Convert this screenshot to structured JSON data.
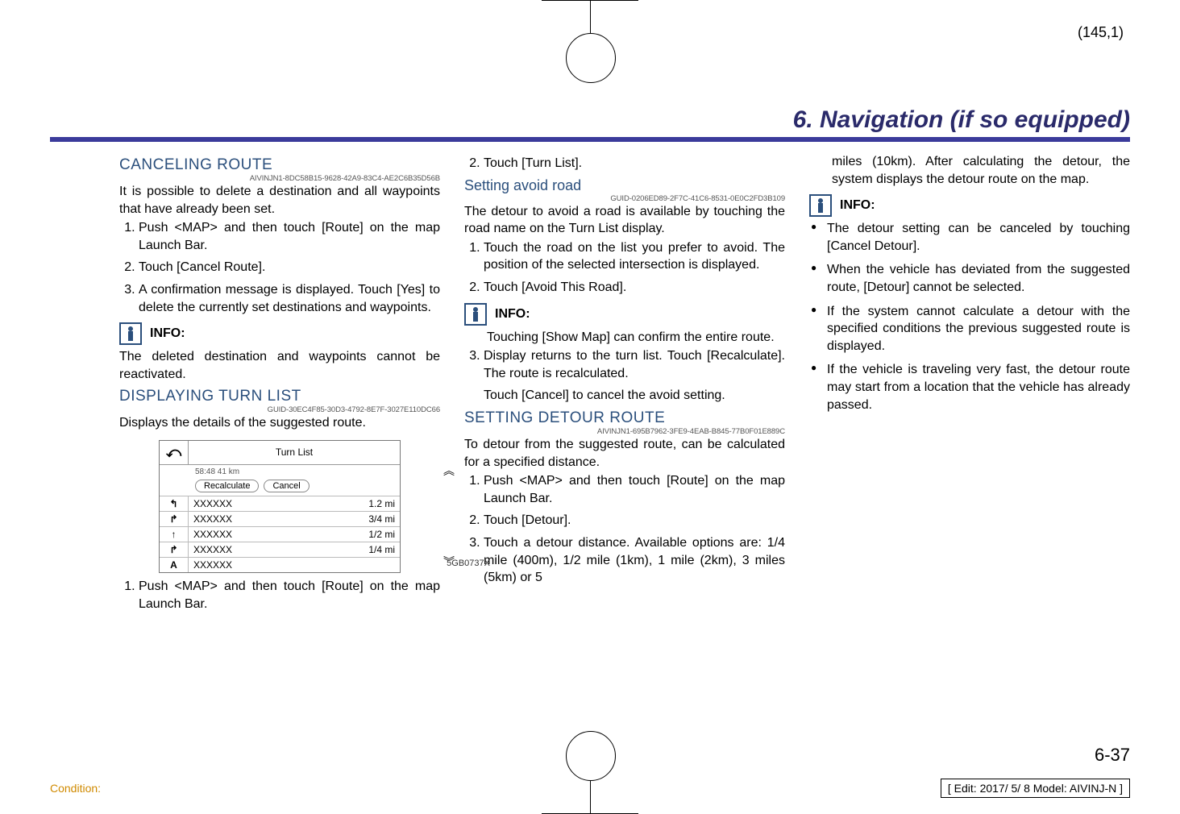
{
  "page_coord": "(145,1)",
  "section_title": "6. Navigation (if so equipped)",
  "col1": {
    "h_cancel": "CANCELING ROUTE",
    "guid_cancel": "AIVINJN1-8DC58B15-9628-42A9-83C4-AE2C6B35D56B",
    "p_cancel": "It is possible to delete a destination and all waypoints that have already been set.",
    "cancel_steps": [
      "Push <MAP> and then touch [Route] on the map Launch Bar.",
      "Touch [Cancel Route].",
      "A confirmation message is displayed. Touch [Yes] to delete the currently set destinations and waypoints."
    ],
    "info_label": "INFO:",
    "info_text": "The deleted destination and waypoints cannot be reactivated.",
    "h_turn": "DISPLAYING TURN LIST",
    "guid_turn": "GUID-30EC4F85-30D3-4792-8E7F-3027E110DC66",
    "p_turn": "Displays the details of the suggested route.",
    "turnlist": {
      "title": "Turn List",
      "meta": "58:48    41 km",
      "btn_recalc": "Recalculate",
      "btn_cancel": "Cancel",
      "rows": [
        {
          "dir": "↰",
          "name": "XXXXXX",
          "dist": "1.2 mi"
        },
        {
          "dir": "↱",
          "name": "XXXXXX",
          "dist": "3/4 mi"
        },
        {
          "dir": "↑",
          "name": "XXXXXX",
          "dist": "1/2 mi"
        },
        {
          "dir": "↱",
          "name": "XXXXXX",
          "dist": "1/4 mi"
        },
        {
          "dir": "A",
          "name": "XXXXXX",
          "dist": ""
        }
      ],
      "figref": "5GB0737X"
    },
    "turn_steps_first": "Push <MAP> and then touch [Route] on the map Launch Bar."
  },
  "col2": {
    "turn_step2": "Touch [Turn List].",
    "h_avoid": "Setting avoid road",
    "guid_avoid": "GUID-0206ED89-2F7C-41C6-8531-0E0C2FD3B109",
    "p_avoid": "The detour to avoid a road is available by touching the road name on the Turn List display.",
    "avoid_steps12": [
      "Touch the road on the list you prefer to avoid. The position of the selected intersection is displayed.",
      "Touch [Avoid This Road]."
    ],
    "info_label": "INFO:",
    "info_text": "Touching [Show Map] can confirm the entire route.",
    "avoid_step3a": "Display returns to the turn list. Touch [Recalculate]. The route is recalculated.",
    "avoid_step3b": "Touch [Cancel] to cancel the avoid setting.",
    "h_detour": "SETTING DETOUR ROUTE",
    "guid_detour": "AIVINJN1-695B7962-3FE9-4EAB-B845-77B0F01E889C",
    "p_detour": "To detour from the suggested route, can be calculated for a specified distance.",
    "detour_steps": [
      "Push <MAP> and then touch [Route] on the map Launch Bar.",
      "Touch [Detour].",
      "Touch a detour distance. Available options are: 1/4 mile (400m), 1/2 mile (1km), 1 mile (2km), 3 miles (5km) or 5"
    ]
  },
  "col3": {
    "cont": "miles (10km). After calculating the detour, the system displays the detour route on the map.",
    "info_label": "INFO:",
    "bullets": [
      "The detour setting can be canceled by touching [Cancel Detour].",
      "When the vehicle has deviated from the suggested route, [Detour] cannot be selected.",
      "If the system cannot calculate a detour with the specified conditions the previous suggested route is displayed.",
      "If the vehicle is traveling very fast, the detour route may start from a location that the vehicle has already passed."
    ]
  },
  "page_number": "6-37",
  "footer_left": "Condition:",
  "footer_right": "[ Edit: 2017/ 5/ 8   Model: AIVINJ-N ]"
}
